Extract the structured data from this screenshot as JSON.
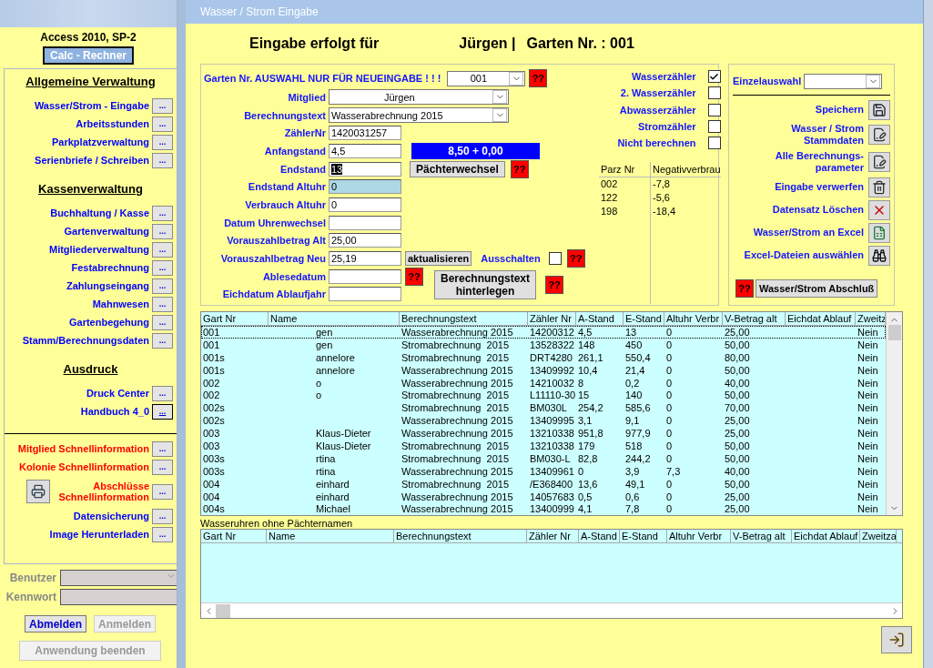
{
  "sidebar": {
    "version": "Access 2010, SP-2",
    "calc_button": "Calc - Rechner",
    "sections": [
      {
        "heading": "Allgemeine Verwaltung",
        "items": [
          {
            "label": "Wasser/Strom - Eingabe",
            "button": "...",
            "color": "#0000ff",
            "focused": false,
            "kind": "plain"
          },
          {
            "label": "Arbeitsstunden",
            "button": "...",
            "color": "#0000ff",
            "focused": false,
            "kind": "plain"
          },
          {
            "label": "Parkplatzverwaltung",
            "button": "...",
            "color": "#0000ff",
            "focused": false,
            "kind": "plain"
          },
          {
            "label": "Serienbriefe / Schreiben",
            "button": "...",
            "color": "#0000ff",
            "focused": false,
            "kind": "plain"
          }
        ]
      },
      {
        "heading": "Kassenverwaltung",
        "items": [
          {
            "label": "Buchhaltung / Kasse",
            "button": "...",
            "color": "#0000ff",
            "focused": false,
            "kind": "plain"
          },
          {
            "label": "Gartenverwaltung",
            "button": "...",
            "color": "#0000ff",
            "focused": false,
            "kind": "plain"
          },
          {
            "label": "Mitgliederverwaltung",
            "button": "...",
            "color": "#0000ff",
            "focused": false,
            "kind": "plain"
          },
          {
            "label": "Festabrechnung",
            "button": "...",
            "color": "#0000ff",
            "focused": false,
            "kind": "plain"
          },
          {
            "label": "Zahlungseingang",
            "button": "...",
            "color": "#0000ff",
            "focused": false,
            "kind": "plain"
          },
          {
            "label": "Mahnwesen",
            "button": "...",
            "color": "#0000ff",
            "focused": false,
            "kind": "plain"
          },
          {
            "label": "Gartenbegehung",
            "button": "...",
            "color": "#0000ff",
            "focused": false,
            "kind": "plain"
          },
          {
            "label": "Stamm/Berechnungsdaten",
            "button": "...",
            "color": "#0000ff",
            "focused": false,
            "kind": "plain"
          }
        ]
      },
      {
        "heading": "Ausdruck",
        "items": [
          {
            "label": "Druck Center",
            "button": "...",
            "color": "#0000ff",
            "focused": false,
            "kind": "plain"
          },
          {
            "label": "Handbuch 4_0",
            "button": "...",
            "color": "#0000ff",
            "focused": true,
            "kind": "plain"
          }
        ]
      },
      {
        "items": [
          {
            "label": "Mitglied Schnellinformation",
            "button": "...",
            "color": "#ff0000",
            "focused": false,
            "kind": "plain"
          },
          {
            "label": "Kolonie Schnellinformation",
            "button": "...",
            "color": "#ff0000",
            "focused": false,
            "kind": "plain"
          },
          {
            "label": "Abschlüsse\nSchnellinformation",
            "button": "...",
            "color": "#ff0000",
            "focused": false,
            "kind": "printer"
          },
          {
            "label": "Datensicherung",
            "button": "...",
            "color": "#0000ff",
            "focused": false,
            "kind": "plain"
          },
          {
            "label": "Image Herunterladen",
            "button": "...",
            "color": "#0000ff",
            "focused": false,
            "kind": "plain"
          }
        ]
      }
    ],
    "login": {
      "user_label": "Benutzer",
      "password_label": "Kennwort",
      "buttons": [
        {
          "label": "Abmelden",
          "disabled": false
        },
        {
          "label": "Anmelden",
          "disabled": true
        },
        {
          "label": "Anwendung beenden",
          "disabled": true
        }
      ]
    }
  },
  "window": {
    "title": "Wasser / Strom Eingabe"
  },
  "header": {
    "prefix": "Eingabe erfolgt für",
    "member": "Jürgen |",
    "garden": "Garten Nr. : 001"
  },
  "form": {
    "garden_select": {
      "label": "Garten Nr. AUSWAHL NUR FÜR NEUEINGABE ! ! !",
      "value": "001",
      "help": "??"
    },
    "fields": [
      {
        "label": "Mitglied",
        "kind": "combo",
        "value": "Jürgen",
        "text_selected": false
      },
      {
        "label": "Berechnungstext",
        "kind": "combo",
        "value": "Wasserabrechnung 2015",
        "text_selected": false
      },
      {
        "label": "ZählerNr",
        "kind": "text",
        "value": "1420031257",
        "text_selected": false
      },
      {
        "label": "Anfangstand",
        "kind": "text",
        "value": "4,5",
        "text_selected": false
      },
      {
        "label": "Endstand",
        "kind": "text",
        "value": "13",
        "text_selected": true
      },
      {
        "label": "Endstand Altuhr",
        "kind": "readonly",
        "value": "0",
        "text_selected": false
      },
      {
        "label": "Verbrauch Altuhr",
        "kind": "text",
        "value": "0",
        "text_selected": false
      },
      {
        "label": "Datum Uhrenwechsel",
        "kind": "text",
        "text_selected": false
      },
      {
        "label": "Vorauszahlbetrag Alt",
        "kind": "text",
        "value": "25,00",
        "text_selected": false
      },
      {
        "label": "Vorauszahlbetrag Neu",
        "kind": "text",
        "value": "25,19",
        "text_selected": false
      },
      {
        "label": "Ablesedatum",
        "kind": "text",
        "text_selected": false,
        "help": "??"
      },
      {
        "label": "Eichdatum Ablaufjahr",
        "kind": "text",
        "text_selected": false
      }
    ],
    "total_display": "8,50 + 0,00",
    "tenant_change": {
      "label": "Pächterwechsel",
      "help": "??"
    },
    "update_button": "aktualisieren",
    "switch_off": {
      "label": "Ausschalten",
      "checked": false,
      "help": "??"
    },
    "store_text": {
      "label": "Berechnungstext\nhinterlegen",
      "help": "??"
    },
    "meters": [
      {
        "label": "Wasserzähler",
        "checked": true
      },
      {
        "label": "2. Wasserzähler",
        "checked": false
      },
      {
        "label": "Abwasserzähler",
        "checked": false
      },
      {
        "label": "Stromzähler",
        "checked": false
      },
      {
        "label": "Nicht berechnen",
        "checked": false
      }
    ],
    "negative_table": {
      "columns": [
        "Parz Nr",
        "Negativverbrau"
      ],
      "rows": [
        [
          "002",
          "-7,8"
        ],
        [
          "122",
          "-5,6"
        ],
        [
          "198",
          "-18,4"
        ]
      ]
    }
  },
  "actions": {
    "single_select_label": "Einzelauswahl",
    "items": [
      {
        "label": "Speichern",
        "kind": "save"
      },
      {
        "label": "Wasser / Strom\nStammdaten",
        "kind": "edit"
      },
      {
        "label": "Alle Berechnungs-\nparameter",
        "kind": "edit"
      },
      {
        "label": "Eingabe verwerfen",
        "kind": "trash"
      },
      {
        "label": "Datensatz Löschen",
        "kind": "delete"
      },
      {
        "label": "Wasser/Strom an Excel",
        "kind": "excel"
      },
      {
        "label": "Excel-Dateien auswählen",
        "kind": "binoculars"
      }
    ],
    "closing": {
      "help": "??",
      "label": "Wasser/Strom Abschluß"
    }
  },
  "table": {
    "columns": [
      "Gart Nr",
      "Name",
      "Berechnungstext",
      "Zähler Nr",
      "A-Stand",
      "E-Stand",
      "Altuhr Verbr",
      "V-Betrag alt",
      "Eichdat Ablauf",
      "Zweitz"
    ],
    "rows": [
      {
        "selected": true,
        "cells": [
          "001",
          "gen",
          "Wasserabrechnung 2015",
          "14200312",
          "4,5",
          "13",
          "0",
          "25,00",
          "",
          "Nein"
        ]
      },
      {
        "selected": false,
        "cells": [
          "001",
          "gen",
          "Stromabrechnung  2015",
          "13528322",
          "148",
          "450",
          "0",
          "50,00",
          "",
          "Nein"
        ]
      },
      {
        "selected": false,
        "cells": [
          "001s",
          "annelore",
          "Stromabrechnung  2015",
          "DRT4280",
          "261,1",
          "550,4",
          "0",
          "80,00",
          "",
          "Nein"
        ]
      },
      {
        "selected": false,
        "cells": [
          "001s",
          "annelore",
          "Wasserabrechnung 2015",
          "13409992",
          "10,4",
          "21,4",
          "0",
          "50,00",
          "",
          "Nein"
        ]
      },
      {
        "selected": false,
        "cells": [
          "002",
          "o",
          "Wasserabrechnung 2015",
          "14210032",
          "8",
          "0,2",
          "0",
          "40,00",
          "",
          "Nein"
        ]
      },
      {
        "selected": false,
        "cells": [
          "002",
          "o",
          "Stromabrechnung  2015",
          "L11110-30",
          "15",
          "140",
          "0",
          "50,00",
          "",
          "Nein"
        ]
      },
      {
        "selected": false,
        "cells": [
          "002s",
          "",
          "Stromabrechnung  2015",
          "BM030L",
          "254,2",
          "585,6",
          "0",
          "70,00",
          "",
          "Nein"
        ]
      },
      {
        "selected": false,
        "cells": [
          "002s",
          "",
          "Wasserabrechnung 2015",
          "13409995",
          "3,1",
          "9,1",
          "0",
          "25,00",
          "",
          "Nein"
        ]
      },
      {
        "selected": false,
        "cells": [
          "003",
          "Klaus-Dieter",
          "Wasserabrechnung 2015",
          "13210338",
          "951,8",
          "977,9",
          "0",
          "25,00",
          "",
          "Nein"
        ]
      },
      {
        "selected": false,
        "cells": [
          "003",
          "Klaus-Dieter",
          "Stromabrechnung  2015",
          "13210338",
          "179",
          "518",
          "0",
          "50,00",
          "",
          "Nein"
        ]
      },
      {
        "selected": false,
        "cells": [
          "003s",
          "rtina",
          "Stromabrechnung  2015",
          "BM030-L",
          "82,8",
          "244,2",
          "0",
          "50,00",
          "",
          "Nein"
        ]
      },
      {
        "selected": false,
        "cells": [
          "003s",
          "rtina",
          "Wasserabrechnung 2015",
          "13409961",
          "0",
          "3,9",
          "7,3",
          "40,00",
          "",
          "Nein"
        ]
      },
      {
        "selected": false,
        "cells": [
          "004",
          "einhard",
          "Stromabrechnung  2015",
          "/E368400",
          "13,6",
          "49,1",
          "0",
          "50,00",
          "",
          "Nein"
        ]
      },
      {
        "selected": false,
        "cells": [
          "004",
          "einhard",
          "Wasserabrechnung 2015",
          "14057683",
          "0,5",
          "0,6",
          "0",
          "25,00",
          "",
          "Nein"
        ]
      },
      {
        "selected": false,
        "cells": [
          "004s",
          "Michael",
          "Wasserabrechnung 2015",
          "13400999",
          "4,1",
          "7,8",
          "0",
          "25,00",
          "",
          "Nein"
        ]
      }
    ]
  },
  "orphan_table": {
    "title": "Wasseruhren ohne Pächternamen",
    "columns": [
      "Gart Nr",
      "Name",
      "Berechnungstext",
      "Zähler Nr",
      "A-Stand",
      "E-Stand",
      "Altuhr Verbr",
      "V-Betrag alt",
      "Eichdat Ablauf",
      "Zweitza"
    ]
  }
}
